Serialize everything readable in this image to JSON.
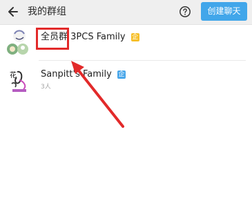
{
  "header": {
    "back_icon": "arrow-left-icon",
    "title": "我的群组",
    "help_icon": "question-circle-icon",
    "create_button_label": "创建聊天",
    "create_button_color": "#41a6ea"
  },
  "groups": [
    {
      "name": "全员群 3PCS Family",
      "badge": "企",
      "badge_color": "#f6bf2a",
      "member_text": ""
    },
    {
      "name": "Sanpitt's Family",
      "badge": "企",
      "badge_color": "#4aa7ea",
      "member_text": "3人"
    }
  ],
  "annotation": {
    "highlight_color": "#e22a2a",
    "arrow_color": "#e22a2a"
  }
}
